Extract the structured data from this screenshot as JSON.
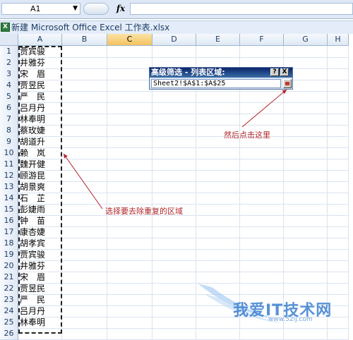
{
  "formula_bar": {
    "name_box": "A1",
    "fx_label": "fx",
    "formula": ""
  },
  "workbook": {
    "title": "新建 Microsoft Office Excel 工作表.xlsx",
    "icon_label": "X"
  },
  "columns": [
    "A",
    "B",
    "C",
    "D",
    "E",
    "F",
    "G",
    "H"
  ],
  "selected_column": "C",
  "rows": [
    {
      "num": "1",
      "a": "贾宾骏"
    },
    {
      "num": "2",
      "a": "井雅芬"
    },
    {
      "num": "3",
      "a": "宋　眉"
    },
    {
      "num": "4",
      "a": "贾昱民"
    },
    {
      "num": "5",
      "a": "严　民"
    },
    {
      "num": "6",
      "a": "吕月丹"
    },
    {
      "num": "7",
      "a": "林奉明"
    },
    {
      "num": "8",
      "a": "蔡玫婕"
    },
    {
      "num": "9",
      "a": "胡道升"
    },
    {
      "num": "10",
      "a": "赖　岚"
    },
    {
      "num": "11",
      "a": "魏开健"
    },
    {
      "num": "12",
      "a": "顾游昆"
    },
    {
      "num": "13",
      "a": "胡景爽"
    },
    {
      "num": "14",
      "a": "石　芷"
    },
    {
      "num": "15",
      "a": "彭婕雨"
    },
    {
      "num": "16",
      "a": "钟　苗"
    },
    {
      "num": "17",
      "a": "康杏婕"
    },
    {
      "num": "18",
      "a": "胡孝宾"
    },
    {
      "num": "19",
      "a": "贾宾骏"
    },
    {
      "num": "20",
      "a": "井雅芬"
    },
    {
      "num": "21",
      "a": "宋　眉"
    },
    {
      "num": "22",
      "a": "贾昱民"
    },
    {
      "num": "23",
      "a": "严　民"
    },
    {
      "num": "24",
      "a": "吕月丹"
    },
    {
      "num": "25",
      "a": "林奉明"
    },
    {
      "num": "26",
      "a": ""
    }
  ],
  "dialog": {
    "title": "高级筛选 - 列表区域:",
    "help_label": "?",
    "close_label": "X",
    "range_value": "Sheet2!$A$1:$A$25"
  },
  "annotations": {
    "click_here": "然后点击这里",
    "select_range": "选择要去除重复的区域"
  },
  "watermark": {
    "main": "我爱IT技术网",
    "sub": "www.52ij.com"
  },
  "colors": {
    "annotation": "#b0262a",
    "selection_header": "#f5c25f",
    "dialog_title": "#0a246a"
  }
}
